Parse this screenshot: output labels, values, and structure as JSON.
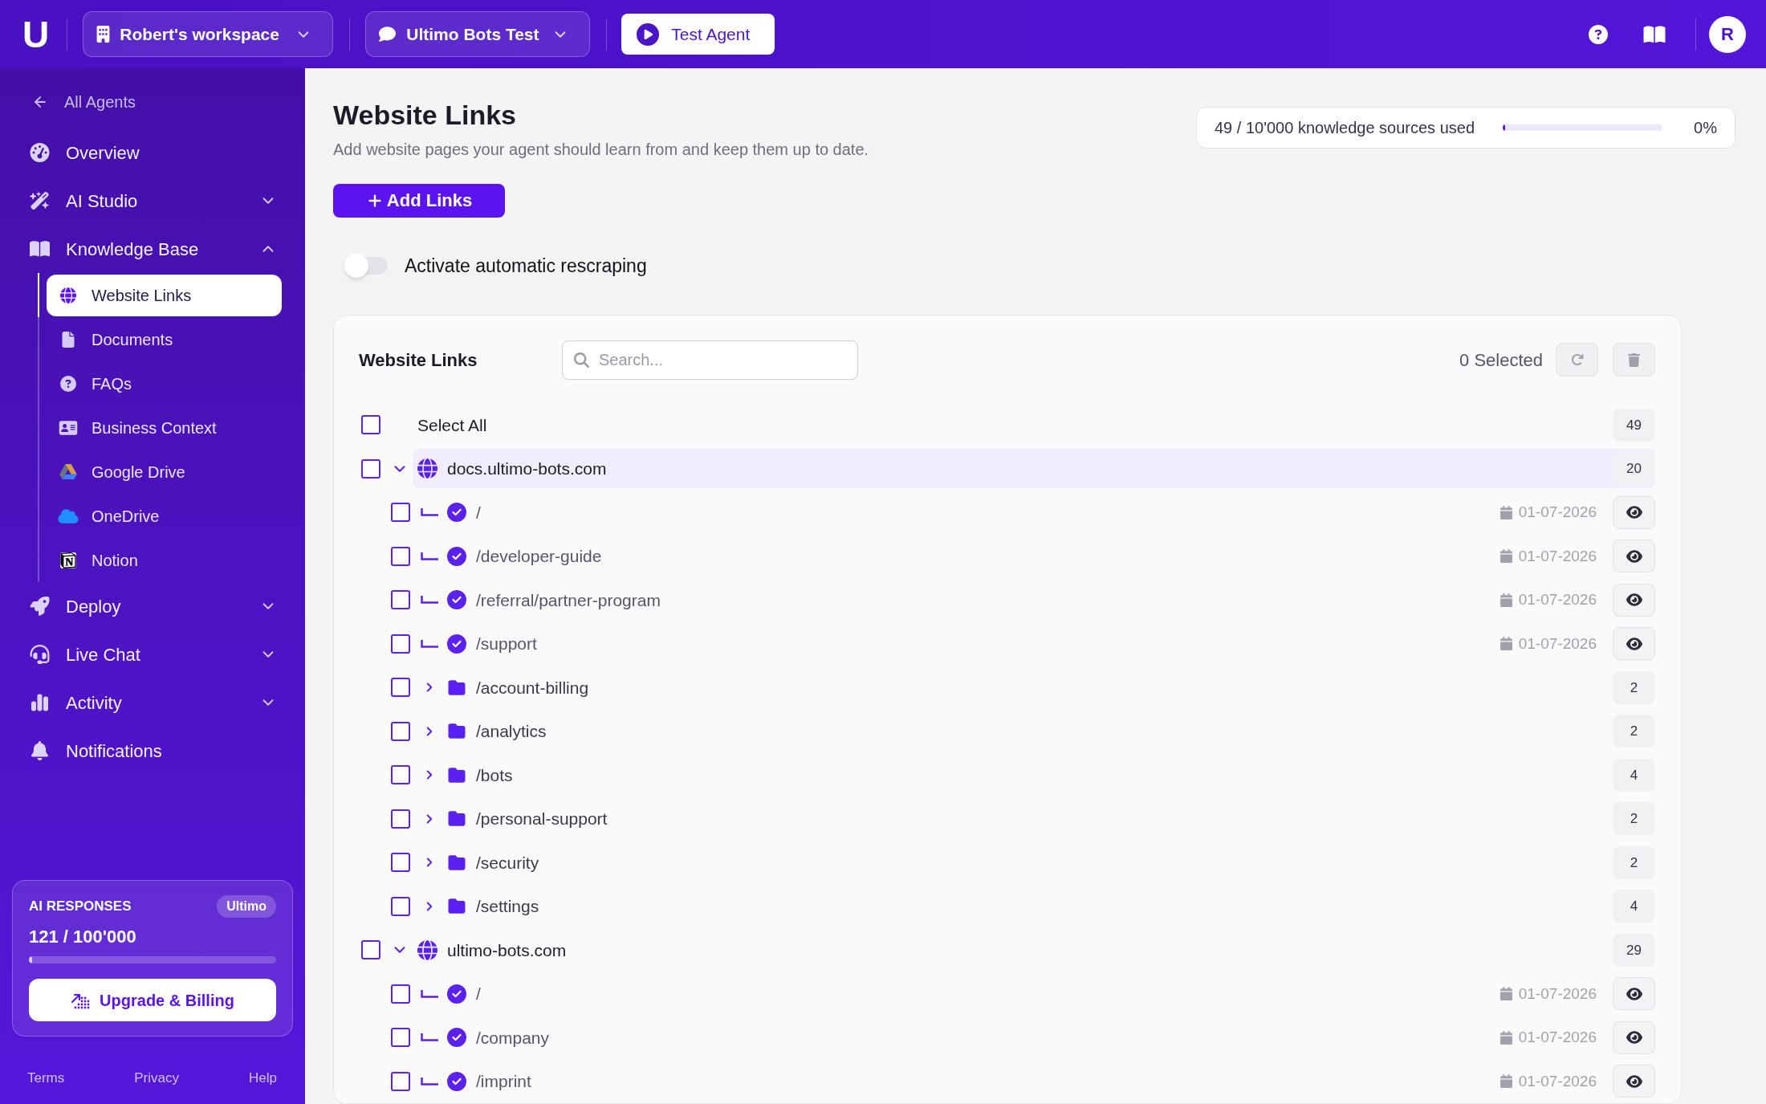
{
  "topbar": {
    "logo": "U",
    "workspace": "Robert's workspace",
    "agent": "Ultimo Bots Test",
    "test_button": "Test Agent",
    "avatar": "R"
  },
  "sidebar": {
    "back": "All Agents",
    "items": [
      {
        "kind": "link",
        "label": "Overview"
      },
      {
        "kind": "group",
        "label": "AI Studio",
        "expanded": false
      },
      {
        "kind": "group",
        "label": "Knowledge Base",
        "expanded": true,
        "children": [
          {
            "label": "Website Links",
            "selected": true
          },
          {
            "label": "Documents",
            "selected": false
          },
          {
            "label": "FAQs",
            "selected": false
          },
          {
            "label": "Business Context",
            "selected": false
          },
          {
            "label": "Google Drive",
            "selected": false
          },
          {
            "label": "OneDrive",
            "selected": false
          },
          {
            "label": "Notion",
            "selected": false
          }
        ]
      },
      {
        "kind": "group",
        "label": "Deploy",
        "expanded": false
      },
      {
        "kind": "group",
        "label": "Live Chat",
        "expanded": false
      },
      {
        "kind": "group",
        "label": "Activity",
        "expanded": false
      },
      {
        "kind": "link",
        "label": "Notifications"
      }
    ],
    "usage": {
      "title": "AI RESPONSES",
      "plan": "Ultimo",
      "count": "121 / 100'000",
      "level": 0.0012,
      "button": "Upgrade & Billing"
    },
    "footer": [
      "Terms",
      "Privacy",
      "Help"
    ]
  },
  "page": {
    "title": "Website Links",
    "subtitle": "Add website pages your agent should learn from and keep them up to date.",
    "add_button": "Add Links",
    "quota": {
      "text": "49 / 10'000 knowledge sources used",
      "level": 0.0049,
      "percent": "0%"
    },
    "rescraping": {
      "label": "Activate automatic rescraping",
      "on": false
    }
  },
  "links_panel": {
    "title": "Website Links",
    "search": {
      "placeholder": "Search..."
    },
    "selected_count": "0 Selected",
    "select_all": {
      "label": "Select All",
      "checked": false,
      "count": "49"
    },
    "domains": [
      {
        "label": "docs.ultimo-bots.com",
        "checked": false,
        "expanded": true,
        "highlighted": true,
        "count": "20",
        "children": [
          {
            "kind": "page",
            "label": "/",
            "checked": false,
            "indexed": true,
            "date": "01-07-2026"
          },
          {
            "kind": "page",
            "label": "/developer-guide",
            "checked": false,
            "indexed": true,
            "date": "01-07-2026"
          },
          {
            "kind": "page",
            "label": "/referral/partner-program",
            "checked": false,
            "indexed": true,
            "date": "01-07-2026"
          },
          {
            "kind": "page",
            "label": "/support",
            "checked": false,
            "indexed": true,
            "date": "01-07-2026"
          },
          {
            "kind": "folder",
            "label": "/account-billing",
            "checked": false,
            "expanded": false,
            "count": "2"
          },
          {
            "kind": "folder",
            "label": "/analytics",
            "checked": false,
            "expanded": false,
            "count": "2"
          },
          {
            "kind": "folder",
            "label": "/bots",
            "checked": false,
            "expanded": false,
            "count": "4"
          },
          {
            "kind": "folder",
            "label": "/personal-support",
            "checked": false,
            "expanded": false,
            "count": "2"
          },
          {
            "kind": "folder",
            "label": "/security",
            "checked": false,
            "expanded": false,
            "count": "2"
          },
          {
            "kind": "folder",
            "label": "/settings",
            "checked": false,
            "expanded": false,
            "count": "4"
          }
        ]
      },
      {
        "label": "ultimo-bots.com",
        "checked": false,
        "expanded": true,
        "highlighted": false,
        "count": "29",
        "children": [
          {
            "kind": "page",
            "label": "/",
            "checked": false,
            "indexed": true,
            "date": "01-07-2026"
          },
          {
            "kind": "page",
            "label": "/company",
            "checked": false,
            "indexed": true,
            "date": "01-07-2026"
          },
          {
            "kind": "page",
            "label": "/imprint",
            "checked": false,
            "indexed": true,
            "date": "01-07-2026"
          }
        ]
      }
    ]
  }
}
